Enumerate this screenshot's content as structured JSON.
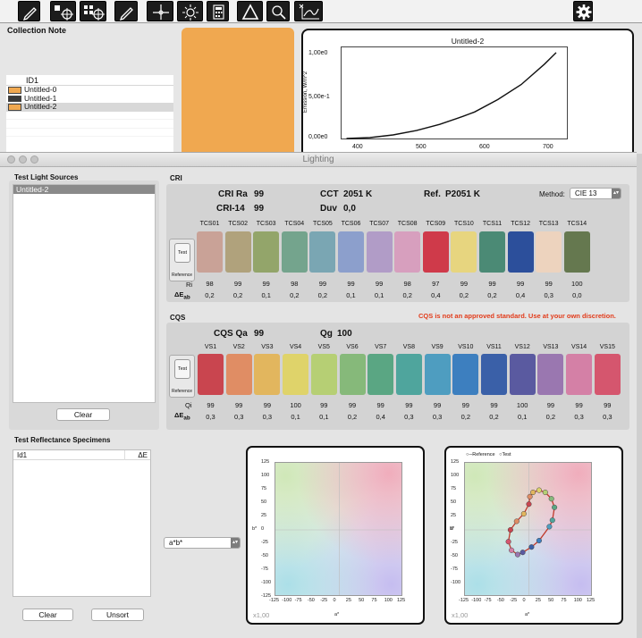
{
  "toolbar": {
    "buttons": [
      "pencil-icon",
      "target-single-icon",
      "target-grid-icon",
      "pencil-alt-icon",
      "crosshair-icon",
      "sun-icon",
      "calculator-icon",
      "delta-icon",
      "magnifier-icon",
      "spectrum-icon"
    ],
    "settings_icon": "gear-icon"
  },
  "collection": {
    "title": "Collection Note",
    "column_header": "ID1",
    "items": [
      {
        "label": "Untitled-0",
        "color": "#f0a850",
        "selected": false
      },
      {
        "label": "Untitled-1",
        "color": "#3a3a3a",
        "selected": false
      },
      {
        "label": "Untitled-2",
        "color": "#f0a850",
        "selected": true
      }
    ],
    "preview_color": "#f0a850"
  },
  "spectrum": {
    "title": "Untitled-2",
    "ylabel": "Emission, W/m^2",
    "yticks": [
      "1,00e0",
      "5,00e-1",
      "0,00e0"
    ],
    "xticks": [
      "400",
      "500",
      "600",
      "700"
    ]
  },
  "lighting": {
    "title": "Lighting",
    "sources_title": "Test Light Sources",
    "sources": [
      "Untitled-2"
    ],
    "clear_label": "Clear",
    "cri": {
      "section": "CRI",
      "ra_label": "CRI Ra",
      "ra_value": "99",
      "cct_label": "CCT",
      "cct_value": "2051 K",
      "ref_label": "Ref.",
      "ref_value": "P2051 K",
      "cri14_label": "CRI-14",
      "cri14_value": "99",
      "duv_label": "Duv",
      "duv_value": "0,0",
      "method_label": "Method:",
      "method_value": "CIE 13",
      "test_label": "Test",
      "reference_label": "Reference",
      "ri_label": "Ri",
      "de_label": "ΔE",
      "de_sub": "ab",
      "samples": [
        {
          "name": "TCS01",
          "color": "#c9a297",
          "ri": "98",
          "de": "0,2"
        },
        {
          "name": "TCS02",
          "color": "#b0a27c",
          "ri": "99",
          "de": "0,2"
        },
        {
          "name": "TCS03",
          "color": "#93a56a",
          "ri": "99",
          "de": "0,1"
        },
        {
          "name": "TCS04",
          "color": "#74a48d",
          "ri": "98",
          "de": "0,2"
        },
        {
          "name": "TCS05",
          "color": "#7aa6b3",
          "ri": "99",
          "de": "0,2"
        },
        {
          "name": "TCS06",
          "color": "#8c9fcc",
          "ri": "99",
          "de": "0,1"
        },
        {
          "name": "TCS07",
          "color": "#b19cc7",
          "ri": "99",
          "de": "0,1"
        },
        {
          "name": "TCS08",
          "color": "#d79fbe",
          "ri": "98",
          "de": "0,2"
        },
        {
          "name": "TCS09",
          "color": "#cf3a4a",
          "ri": "97",
          "de": "0,4"
        },
        {
          "name": "TCS10",
          "color": "#e7d57f",
          "ri": "99",
          "de": "0,2"
        },
        {
          "name": "TCS11",
          "color": "#4b8a75",
          "ri": "99",
          "de": "0,2"
        },
        {
          "name": "TCS12",
          "color": "#2c4f9b",
          "ri": "99",
          "de": "0,4"
        },
        {
          "name": "TCS13",
          "color": "#edd3be",
          "ri": "99",
          "de": "0,3"
        },
        {
          "name": "TCS14",
          "color": "#65784f",
          "ri": "100",
          "de": "0,0"
        }
      ]
    },
    "cqs": {
      "section": "CQS",
      "qa_label": "CQS Qa",
      "qa_value": "99",
      "qg_label": "Qg",
      "qg_value": "100",
      "warning": "CQS is not an approved standard. Use at your own discretion.",
      "qi_label": "Qi",
      "samples": [
        {
          "name": "VS1",
          "color": "#c9454f",
          "qi": "99",
          "de": "0,3"
        },
        {
          "name": "VS2",
          "color": "#e08d64",
          "qi": "99",
          "de": "0,3"
        },
        {
          "name": "VS3",
          "color": "#e2b65e",
          "qi": "99",
          "de": "0,3"
        },
        {
          "name": "VS4",
          "color": "#dfd36a",
          "qi": "100",
          "de": "0,1"
        },
        {
          "name": "VS5",
          "color": "#b6cf74",
          "qi": "99",
          "de": "0,1"
        },
        {
          "name": "VS6",
          "color": "#86b97a",
          "qi": "99",
          "de": "0,2"
        },
        {
          "name": "VS7",
          "color": "#5aa683",
          "qi": "99",
          "de": "0,4"
        },
        {
          "name": "VS8",
          "color": "#4fa59d",
          "qi": "99",
          "de": "0,3"
        },
        {
          "name": "VS9",
          "color": "#4e9dc0",
          "qi": "99",
          "de": "0,3"
        },
        {
          "name": "VS10",
          "color": "#3d7fbf",
          "qi": "99",
          "de": "0,2"
        },
        {
          "name": "VS11",
          "color": "#3a60a8",
          "qi": "99",
          "de": "0,2"
        },
        {
          "name": "VS12",
          "color": "#5a5aa0",
          "qi": "100",
          "de": "0,1"
        },
        {
          "name": "VS13",
          "color": "#9a77b0",
          "qi": "99",
          "de": "0,2"
        },
        {
          "name": "VS14",
          "color": "#d480a6",
          "qi": "99",
          "de": "0,3"
        },
        {
          "name": "VS15",
          "color": "#d5566e",
          "qi": "99",
          "de": "0,3"
        }
      ]
    },
    "specimens": {
      "title": "Test Reflectance Specimens",
      "col_id": "Id1",
      "col_de": "ΔE",
      "mode_value": "a*b*",
      "clear_label": "Clear",
      "unsort_label": "Unsort",
      "zoom_label": "x1,00",
      "legend_reference": "Reference",
      "legend_test": "Test",
      "x_axis": "a*",
      "y_axis": "b*",
      "ticks_x": [
        "-125",
        "-100",
        "-75",
        "-50",
        "-25",
        "0",
        "25",
        "50",
        "75",
        "100",
        "125"
      ],
      "ticks_y": [
        "125",
        "100",
        "75",
        "50",
        "25",
        "0",
        "-25",
        "-50",
        "-75",
        "-100",
        "-125"
      ],
      "ticks_x2": [
        "-125",
        "-100",
        "-75",
        "-50",
        "-25",
        "0",
        "25",
        "50",
        "75",
        "100",
        "125"
      ],
      "ticks_y2": [
        "125",
        "100",
        "75",
        "50",
        "25",
        "0",
        "-25",
        "-50",
        "-75",
        "-100"
      ]
    }
  },
  "chart_data": [
    {
      "type": "line",
      "title": "Untitled-2",
      "ylabel": "Emission, W/m^2",
      "xlim": [
        370,
        760
      ],
      "ylim": [
        0,
        1.05
      ],
      "series": [
        {
          "x": [
            380,
            420,
            460,
            500,
            540,
            580,
            600,
            640,
            680,
            720,
            740
          ],
          "y": [
            0.01,
            0.02,
            0.05,
            0.1,
            0.17,
            0.26,
            0.31,
            0.45,
            0.62,
            0.85,
            0.98
          ]
        }
      ]
    },
    {
      "type": "scatter",
      "title": "",
      "xlabel": "a*",
      "ylabel": "b*",
      "xlim": [
        -125,
        125
      ],
      "ylim": [
        -125,
        125
      ],
      "series": [
        {
          "name": "Reference",
          "x": [
            0,
            2,
            8,
            20,
            32,
            44,
            50,
            46,
            40,
            20,
            5,
            -12,
            -22,
            -34,
            -40,
            -36,
            -24,
            -10
          ],
          "y": [
            48,
            62,
            70,
            74,
            70,
            58,
            42,
            18,
            6,
            -20,
            -32,
            -42,
            -46,
            -38,
            -22,
            0,
            16,
            30
          ]
        }
      ]
    }
  ]
}
